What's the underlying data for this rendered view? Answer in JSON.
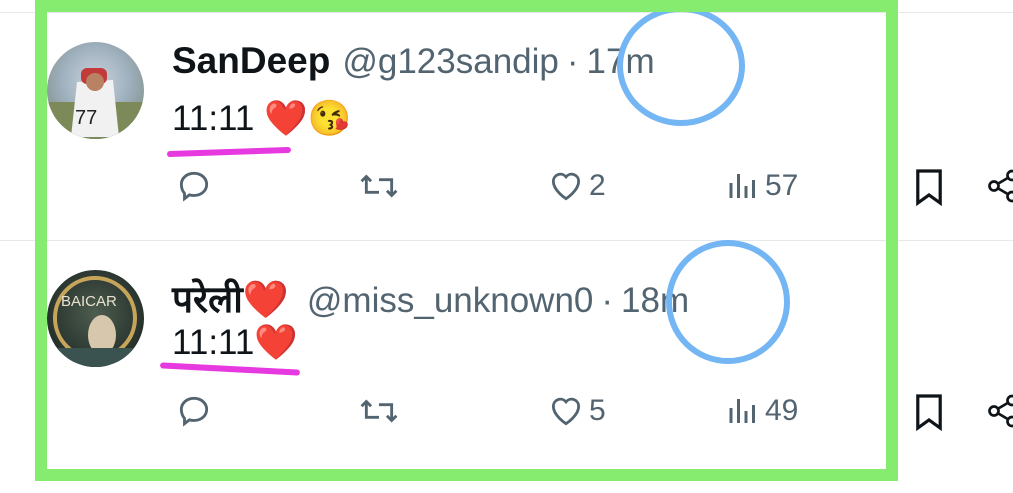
{
  "tweets": [
    {
      "name": "SanDeep",
      "handle": "@g123sandip",
      "separator": "·",
      "time": "17m",
      "text": "11:11",
      "emoji": "❤️😘",
      "replies": "",
      "retweets": "",
      "likes": "2",
      "views": "57"
    },
    {
      "name": "परेली❤️",
      "handle": "@miss_unknown0",
      "separator": "·",
      "time": "18m",
      "text": "11:11",
      "emoji": "❤️",
      "replies": "",
      "retweets": "",
      "likes": "5",
      "views": "49"
    }
  ],
  "colors": {
    "annotation_box": "#86ec6f",
    "annotation_circle": "#74b5f4",
    "annotation_underline": "#e639e0",
    "muted_text": "#536471"
  }
}
